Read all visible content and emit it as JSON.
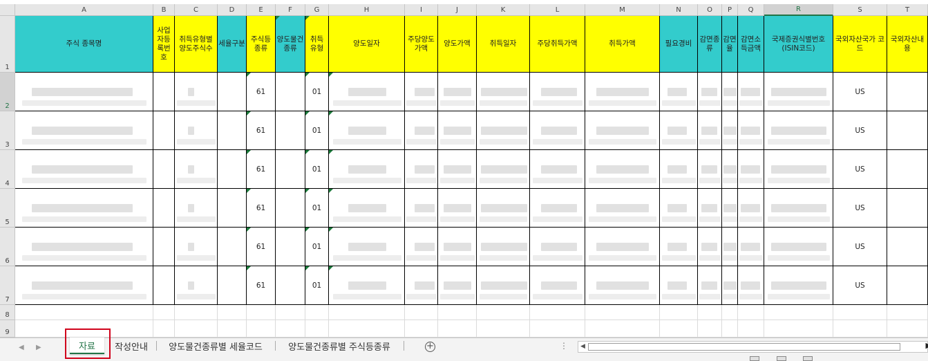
{
  "columns": [
    "A",
    "B",
    "C",
    "D",
    "E",
    "F",
    "G",
    "H",
    "I",
    "J",
    "K",
    "L",
    "M",
    "N",
    "O",
    "P",
    "Q",
    "R",
    "S",
    "T"
  ],
  "selected_column": "R",
  "rows": [
    "1",
    "2",
    "3",
    "4",
    "5",
    "6",
    "7",
    "8",
    "9"
  ],
  "selected_row": "2",
  "headers": {
    "A": "주식 종목명",
    "B": "사업자등록번호",
    "C": "취득유형별 양도주식수",
    "D": "세율구분",
    "E": "주식등 종류",
    "F": "양도물건 종류",
    "G": "취득 유형",
    "H": "양도일자",
    "I": "주당양도가액",
    "J": "양도가액",
    "K": "취득일자",
    "L": "주당취득가액",
    "M": "취득가액",
    "N": "필요경비",
    "O": "감면종류",
    "P": "감면율",
    "Q": "감면소득금액",
    "R": "국제증권식별번호 (ISIN코드)",
    "S": "국외자산국가 코드",
    "T": "국외자산내용"
  },
  "header_colors": {
    "teal": "#33cccc",
    "yellow": "#ffff00"
  },
  "data_rows": [
    {
      "E": "61",
      "G": "01",
      "S": "US"
    },
    {
      "E": "61",
      "G": "01",
      "S": "US"
    },
    {
      "E": "61",
      "G": "01",
      "S": "US"
    },
    {
      "E": "61",
      "G": "01",
      "S": "US"
    },
    {
      "E": "61",
      "G": "01",
      "S": "US"
    },
    {
      "E": "61",
      "G": "01",
      "S": "US"
    }
  ],
  "sheet_tabs": [
    {
      "label": "자료",
      "active": true
    },
    {
      "label": "작성안내",
      "active": false
    },
    {
      "label": "양도물건종류별 세율코드",
      "active": false
    },
    {
      "label": "양도물건종류별 주식등종류",
      "active": false
    }
  ],
  "icons": {
    "add_sheet": "plus-circle-icon",
    "scroll_left": "scroll-left-icon",
    "scroll_right": "scroll-right-icon"
  }
}
